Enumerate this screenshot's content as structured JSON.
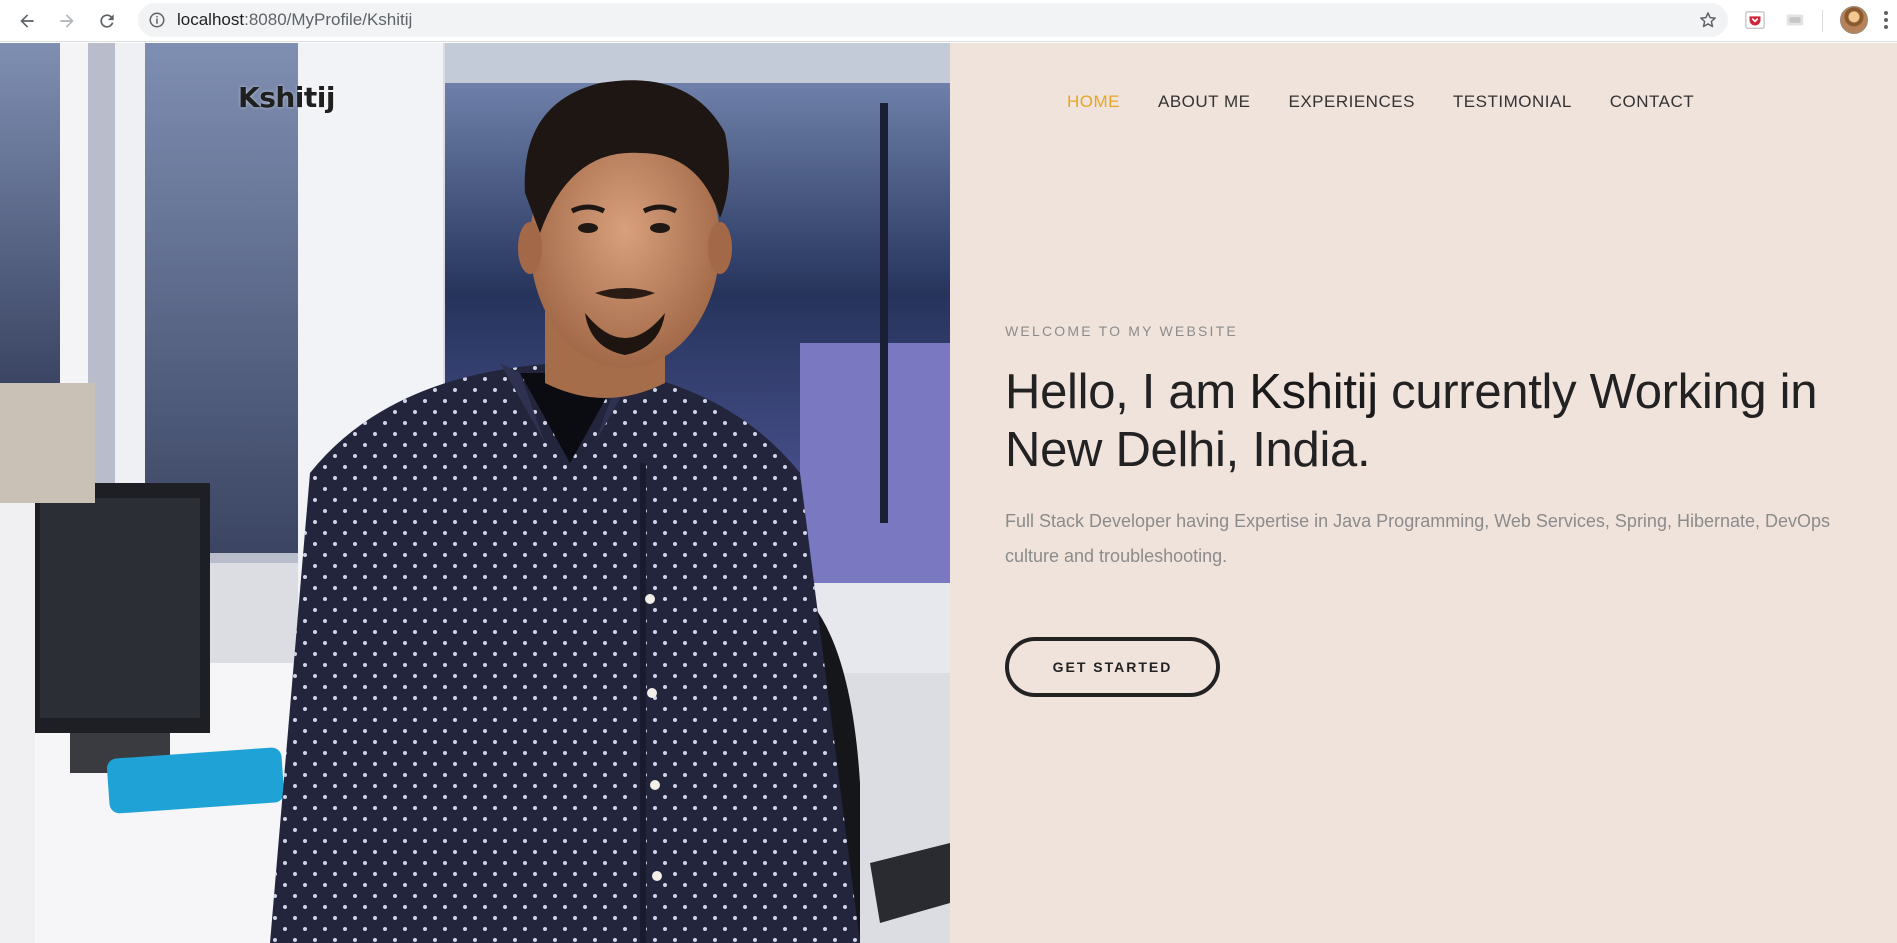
{
  "browser": {
    "url_host": "localhost",
    "url_rest": ":8080/MyProfile/Kshitij",
    "back_icon": "arrow-left-icon",
    "forward_icon": "arrow-right-icon",
    "reload_icon": "reload-icon",
    "info_icon": "info-icon",
    "bookmark_icon": "star-icon",
    "extensions": [
      "pocket-extension-icon",
      "extension-icon"
    ],
    "profile_icon": "avatar",
    "menu_icon": "more-vertical-icon"
  },
  "site": {
    "brand": "Kshitij",
    "nav": [
      {
        "label": "HOME",
        "active": true
      },
      {
        "label": "ABOUT ME",
        "active": false
      },
      {
        "label": "EXPERIENCES",
        "active": false
      },
      {
        "label": "TESTIMONIAL",
        "active": false
      },
      {
        "label": "CONTACT",
        "active": false
      }
    ],
    "accent_color": "#e8a525",
    "background_color": "#f0e3dc"
  },
  "hero": {
    "eyebrow": "WELCOME TO MY WEBSITE",
    "headline_prefix": "Hello, I am ",
    "headline_name": "Kshitij",
    "headline_suffix": " currently Working in New Delhi, India.",
    "description": "Full Stack Developer having Expertise in Java Programming, Web Services, Spring, Hibernate, DevOps culture and troubleshooting.",
    "cta_label": "GET STARTED"
  }
}
